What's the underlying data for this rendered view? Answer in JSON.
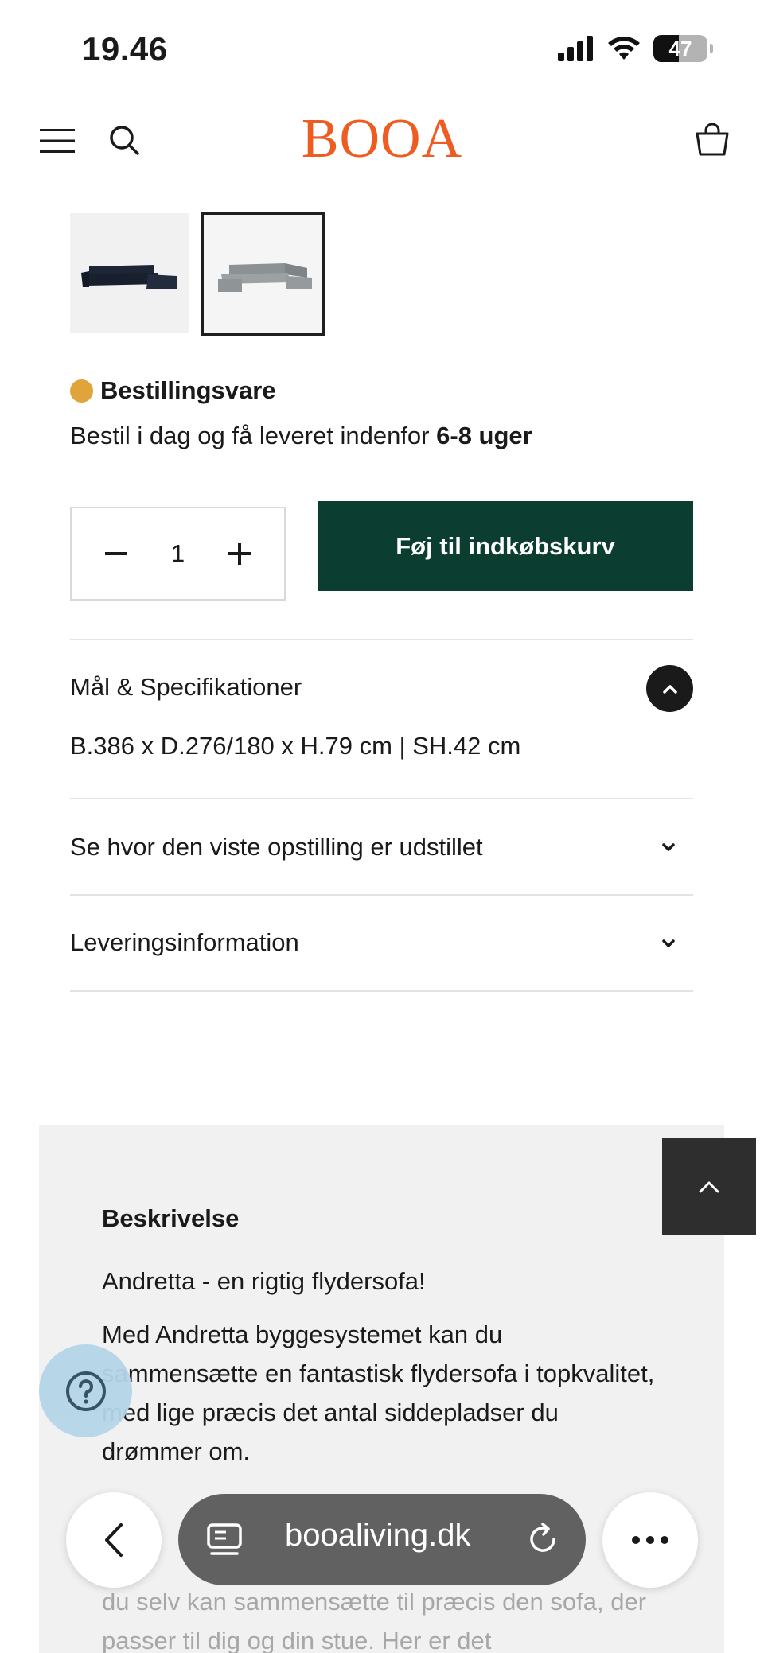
{
  "status_bar": {
    "time": "19.46",
    "battery_percent": "47",
    "battery_level": 0.47,
    "icons": [
      "signal-icon",
      "wifi-icon",
      "battery-icon"
    ]
  },
  "header": {
    "logo": "BOOA",
    "logo_color": "#ef5c22",
    "icons": [
      "menu-icon",
      "search-icon",
      "cart-icon"
    ]
  },
  "gallery": {
    "selected_index": 1,
    "thumbnails": [
      {
        "name": "sofa-dark-blue-thumbnail",
        "color": "#1d2636"
      },
      {
        "name": "sofa-grey-thumbnail",
        "color": "#8c9294"
      }
    ]
  },
  "availability": {
    "status_label": "Bestillingsvare",
    "status_color": "#e0a43a",
    "delivery_text": "Bestil i dag og få leveret indenfor ",
    "delivery_time": "6-8 uger"
  },
  "purchase": {
    "quantity": "1",
    "add_to_cart_label": "Føj til indkøbskurv",
    "button_color": "#0b3d30"
  },
  "accordions": [
    {
      "title": "Mål & Specifikationer",
      "expanded": true,
      "content": "B.386 x D.276/180 x H.79 cm | SH.42 cm"
    },
    {
      "title": "Se hvor den viste opstilling er udstillet",
      "expanded": false
    },
    {
      "title": "Leveringsinformation",
      "expanded": false
    }
  ],
  "description": {
    "heading": "Beskrivelse",
    "intro": "Andretta - en rigtig flydersofa!",
    "paragraph1": "Med Andretta byggesystemet kan du sammensætte en fantastisk flydersofa i topkvalitet, med lige præcis det antal siddepladser du drømmer om.",
    "paragraph2_visible": "du selv kan sammensætte til præcis den sofa, der passer til dig og din stue. Her er det"
  },
  "browser": {
    "url": "booaliving.dk",
    "icons": [
      "back-icon",
      "reader-icon",
      "reload-icon",
      "more-icon"
    ]
  }
}
